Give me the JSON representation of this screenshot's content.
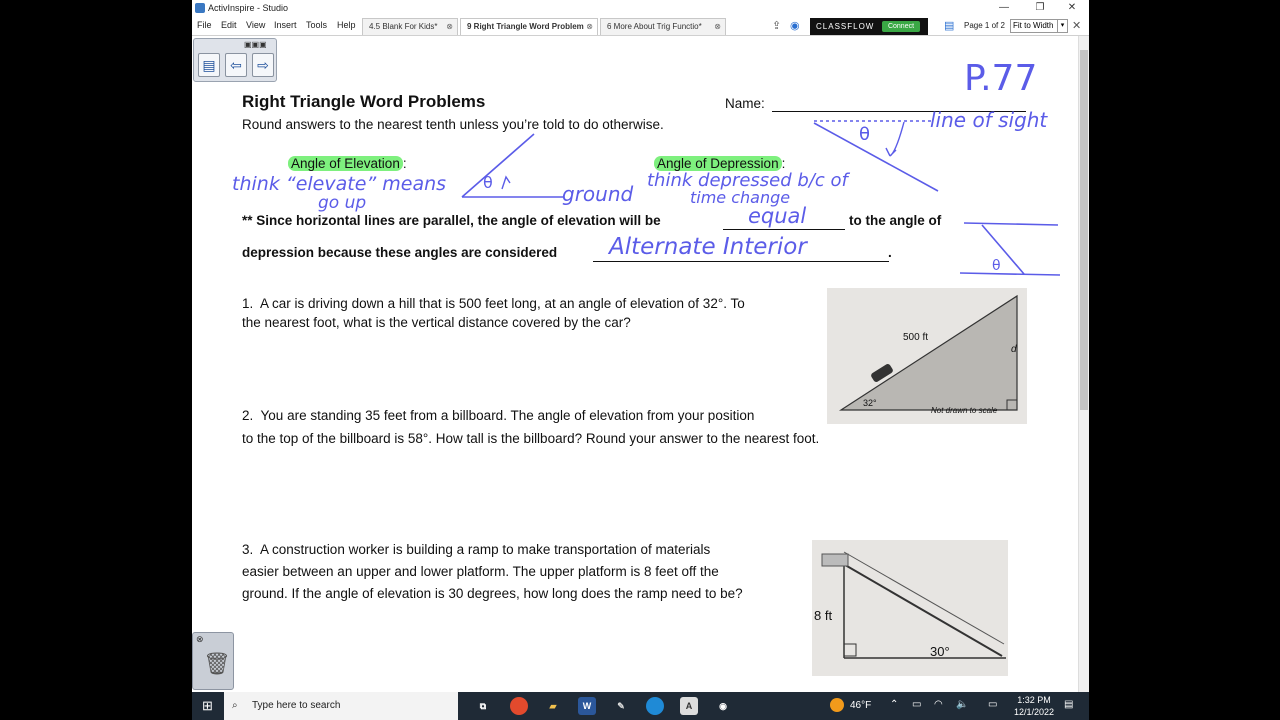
{
  "window": {
    "title": "ActivInspire - Studio",
    "controls": [
      "—",
      "❐",
      "✕"
    ]
  },
  "menu": [
    "File",
    "Edit",
    "View",
    "Insert",
    "Tools",
    "Help"
  ],
  "tabs": [
    {
      "label": "4.5 Blank For Kids*",
      "active": false
    },
    {
      "label": "9 Right Triangle Word Problem",
      "active": true
    },
    {
      "label": "6 More About Trig Functio*",
      "active": false
    }
  ],
  "classflow": {
    "label": "CLASSFLOW",
    "connect": "Connect"
  },
  "page_indicator": "Page 1 of 2",
  "zoom": "Fit to Width",
  "worksheet": {
    "title": "Right Triangle Word Problems",
    "name_label": "Name:",
    "instructions": "Round answers to the nearest tenth unless you’re told to do otherwise.",
    "angle_elevation": "Angle of Elevation",
    "angle_depression": "Angle of Depression",
    "statement_a": "** Since horizontal lines are parallel, the angle of elevation will be",
    "statement_b": "to the angle of",
    "statement_c": "depression because these angles are considered",
    "statement_end": ".",
    "problems": [
      {
        "num": "1.",
        "line1": "A car is driving down a hill that is 500 feet long, at an angle of elevation of 32°.  To",
        "line2": "the nearest foot, what is the vertical distance covered by the car?"
      },
      {
        "num": "2.",
        "line1": "You are standing 35 feet from a billboard.  The angle of elevation from your position",
        "line2": "to the top of the billboard is 58°.  How tall is the billboard?  Round your answer to the nearest foot."
      },
      {
        "num": "3.",
        "line1": "A construction worker is building a ramp to make transportation of materials",
        "line2": "easier between an upper and lower platform.  The upper platform is 8 feet off the",
        "line3": "ground.  If the angle of elevation is 30 degrees, how long does the ramp need to be?"
      }
    ],
    "fig1": {
      "hyp": "500 ft",
      "side": "d",
      "angle": "32°",
      "note": "Not drawn to scale"
    },
    "fig3": {
      "height": "8 ft",
      "angle": "30°"
    }
  },
  "handwriting": {
    "page": "P.77",
    "line_of_sight": "line of sight",
    "theta": "θ",
    "think_elevate_1": "think “elevate” means",
    "think_elevate_2": "go up",
    "ground": "ground",
    "think_depressed_1": "think depressed b/c of",
    "think_depressed_2": "time change",
    "equal": "equal",
    "alternate": "Alternate Interior"
  },
  "taskbar": {
    "search_placeholder": "Type here to search",
    "weather": "46°F",
    "time": "1:32 PM",
    "date": "12/1/2022"
  },
  "colors": {
    "ink": "#5b5ce8",
    "highlight": "#7ef07e"
  }
}
